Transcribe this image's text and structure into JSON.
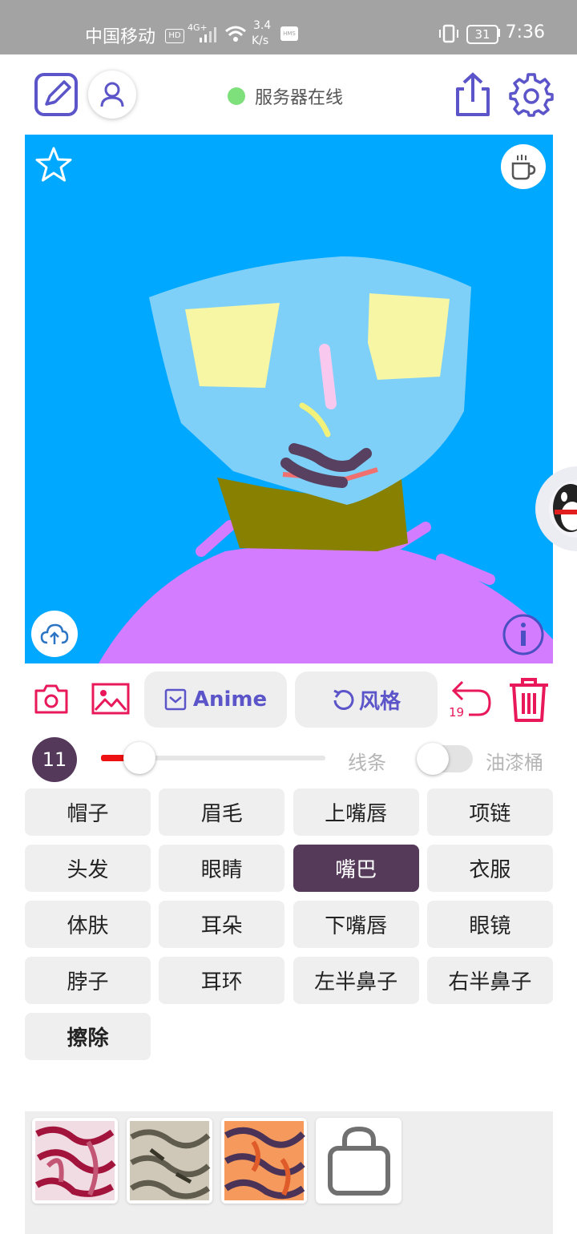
{
  "status_bar": {
    "carrier": "中国移动",
    "hd": "HD",
    "network": "4G+",
    "speed_value": "3.4",
    "speed_unit": "K/s",
    "hms": "HMS",
    "battery": "31",
    "time": "7:36"
  },
  "top_bar": {
    "server_status": "服务器在线",
    "icons": [
      "edit-icon",
      "user-icon",
      "share-icon",
      "gear-icon"
    ],
    "status_color": "#7ee07b"
  },
  "canvas": {
    "background": "#00a8ff",
    "icons": [
      "star-icon",
      "cup-icon",
      "cloud-upload-icon",
      "info-icon"
    ]
  },
  "toolbar": {
    "anime_label": "Anime",
    "style_label": "风格",
    "undo_count": "19",
    "icons": [
      "camera-icon",
      "image-icon",
      "anime-checkbox-icon",
      "refresh-icon",
      "undo-icon",
      "trash-icon"
    ],
    "accent": "#e8185a",
    "pill_text_color": "#5b55c9"
  },
  "brush": {
    "size": "11",
    "size_fraction": 0.14,
    "lines_label": "线条",
    "bucket_label": "油漆桶",
    "bucket_enabled": false
  },
  "categories": [
    {
      "label": "帽子"
    },
    {
      "label": "眉毛"
    },
    {
      "label": "上嘴唇"
    },
    {
      "label": "项链"
    },
    {
      "label": "头发"
    },
    {
      "label": "眼睛"
    },
    {
      "label": "嘴巴"
    },
    {
      "label": "衣服"
    },
    {
      "label": "体肤"
    },
    {
      "label": "耳朵"
    },
    {
      "label": "下嘴唇"
    },
    {
      "label": "眼镜"
    },
    {
      "label": "脖子"
    },
    {
      "label": "耳环"
    },
    {
      "label": "左半鼻子"
    },
    {
      "label": "右半鼻子"
    },
    {
      "label": "擦除"
    }
  ],
  "selected_category": "嘴巴",
  "active_color": "#553a5a",
  "textures": {
    "items": [
      "texture-pink",
      "texture-gray",
      "texture-orange"
    ],
    "shop_icon": "bag-icon"
  }
}
